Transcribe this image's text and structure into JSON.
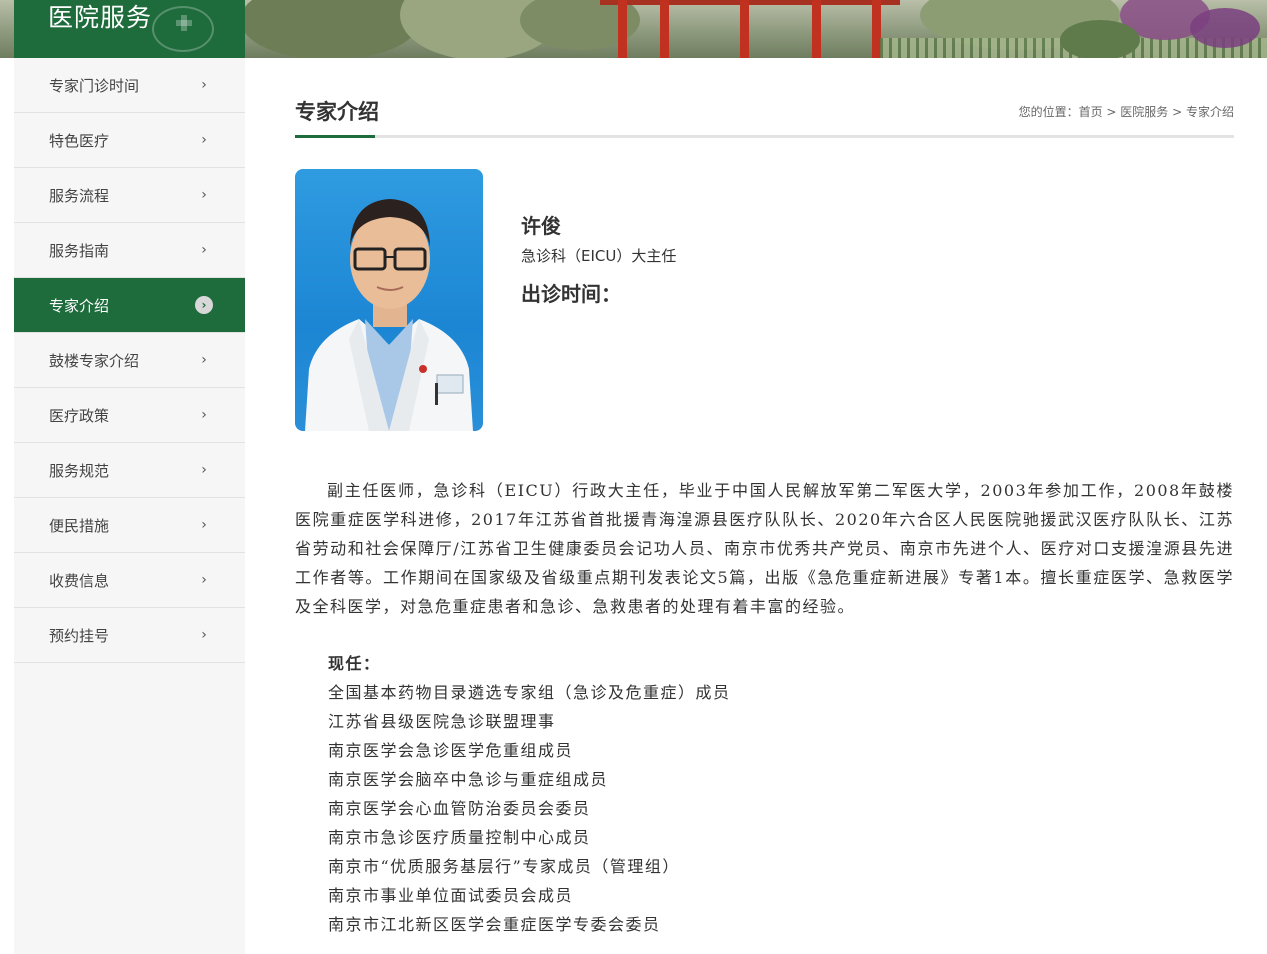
{
  "section": {
    "title": "医院服务"
  },
  "sidebar": {
    "items": [
      {
        "label": "专家门诊时间",
        "active": false
      },
      {
        "label": "特色医疗",
        "active": false
      },
      {
        "label": "服务流程",
        "active": false
      },
      {
        "label": "服务指南",
        "active": false
      },
      {
        "label": "专家介绍",
        "active": true
      },
      {
        "label": "鼓楼专家介绍",
        "active": false
      },
      {
        "label": "医疗政策",
        "active": false
      },
      {
        "label": "服务规范",
        "active": false
      },
      {
        "label": "便民措施",
        "active": false
      },
      {
        "label": "收费信息",
        "active": false
      },
      {
        "label": "预约挂号",
        "active": false
      }
    ],
    "chevron_icon": "chevron-right-icon"
  },
  "page": {
    "title": "专家介绍"
  },
  "breadcrumb": {
    "prefix": "您的位置：",
    "items": [
      "首页",
      "医院服务",
      "专家介绍"
    ],
    "separator": " > "
  },
  "doctor": {
    "name": "许俊",
    "title": "急诊科（EICU）大主任",
    "visit_label": "出诊时间：",
    "bio": "副主任医师，急诊科（EICU）行政大主任，毕业于中国人民解放军第二军医大学，2003年参加工作，2008年鼓楼医院重症医学科进修，2017年江苏省首批援青海湟源县医疗队队长、2020年六合区人民医院驰援武汉医疗队队长、江苏省劳动和社会保障厅/江苏省卫生健康委员会记功人员、南京市优秀共产党员、南京市先进个人、医疗对口支援湟源县先进工作者等。工作期间在国家级及省级重点期刊发表论文5篇，出版《急危重症新进展》专著1本。擅长重症医学、急救医学及全科医学，对急危重症患者和急诊、急救患者的处理有着丰富的经验。",
    "posts_label": "现任：",
    "posts": [
      "全国基本药物目录遴选专家组（急诊及危重症）成员",
      "江苏省县级医院急诊联盟理事",
      "南京医学会急诊医学危重组成员",
      "南京医学会脑卒中急诊与重症组成员",
      "南京医学会心血管防治委员会委员",
      "南京市急诊医疗质量控制中心成员",
      "南京市“优质服务基层行”专家成员（管理组）",
      "南京市事业单位面试委员会成员",
      "南京市江北新区医学会重症医学专委会委员"
    ]
  },
  "colors": {
    "brand_green": "#1e6b3c",
    "photo_blue": "#2590dc"
  }
}
